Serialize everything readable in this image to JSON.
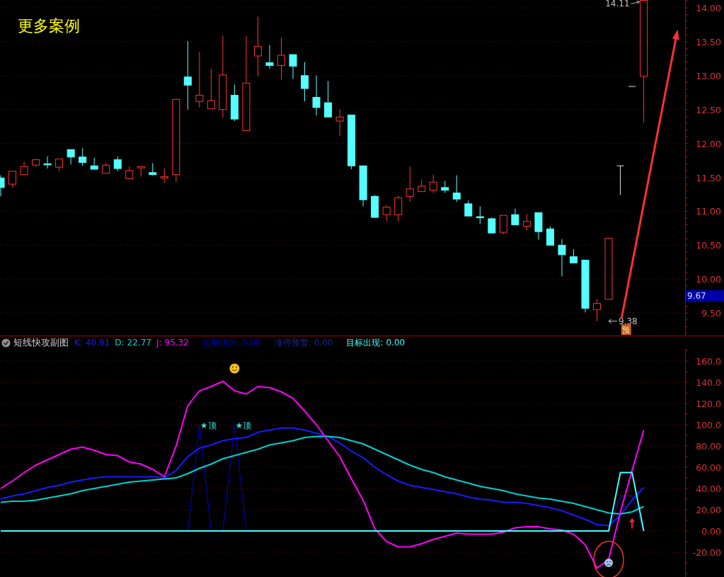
{
  "price_panel": {
    "overlay_label": "更多案例",
    "axis_labels": [
      "14.00",
      "13.50",
      "13.00",
      "12.50",
      "12.00",
      "11.50",
      "11.00",
      "10.50",
      "10.00",
      "9.50"
    ],
    "high_label": "14.11",
    "low_label": "9.38",
    "forecast_badge": "预",
    "price_tag": "9.67",
    "marks": [
      {
        "kind": "forecast_range"
      },
      {
        "kind": "forecast_level"
      },
      {
        "kind": "trend_arrow"
      }
    ]
  },
  "indicator_panel": {
    "title": "短线快攻副图",
    "legend_values": [
      "40.91",
      "22.77",
      "95.32",
      "0.00",
      "0.00",
      "0.00"
    ],
    "chart_data": {
      "type": "line",
      "ylim": [
        -43.3,
        171.3
      ],
      "grid": true,
      "yticks": [
        {
          "value": 160,
          "label": "160.0"
        },
        {
          "value": 140,
          "label": "140.0"
        },
        {
          "value": 120,
          "label": "120.0"
        },
        {
          "value": 100,
          "label": "100.0"
        },
        {
          "value": 80,
          "label": "80.00"
        },
        {
          "value": 60,
          "label": "60.00"
        },
        {
          "value": 40,
          "label": "40.00"
        },
        {
          "value": 20,
          "label": "20.00"
        },
        {
          "value": 0,
          "label": "0.00"
        },
        {
          "value": -20,
          "label": "-20.00"
        }
      ],
      "series": [
        {
          "name": "K:",
          "color": "#1a1aff",
          "values": [
            30,
            33,
            35,
            38,
            41,
            43,
            46,
            48,
            50,
            51,
            51,
            51,
            51,
            51,
            50,
            57,
            70,
            78,
            81,
            85,
            87,
            88,
            93,
            95,
            97,
            97,
            95,
            92,
            89,
            83,
            75,
            69,
            60,
            53,
            47,
            43,
            41,
            39,
            37,
            35,
            32,
            30,
            29,
            27,
            27,
            26,
            24,
            22,
            19,
            15,
            11,
            6,
            5,
            15,
            29,
            41
          ]
        },
        {
          "name": "D:",
          "color": "#00d0d0",
          "values": [
            27,
            28,
            28,
            29,
            31,
            33,
            35,
            38,
            40,
            42,
            44,
            46,
            47,
            48,
            49,
            50,
            54,
            59,
            63,
            68,
            71,
            74,
            77,
            81,
            83,
            85,
            88,
            89,
            89,
            88,
            85,
            82,
            77,
            72,
            67,
            62,
            58,
            55,
            51,
            48,
            45,
            42,
            40,
            38,
            35,
            33,
            31,
            30,
            28,
            26,
            23,
            20,
            17,
            16,
            18,
            23
          ]
        },
        {
          "name": "J:",
          "color": "#ff00ff",
          "values": [
            40,
            47,
            55,
            62,
            67,
            72,
            77,
            79,
            76,
            72,
            71,
            65,
            63,
            58,
            51,
            80,
            118,
            132,
            136,
            141,
            132,
            129,
            136,
            135,
            131,
            125,
            113,
            100,
            85,
            70,
            49,
            29,
            2,
            -10,
            -15,
            -15,
            -12,
            -8,
            -5,
            -2,
            -3,
            -3,
            -3,
            -1,
            3,
            4,
            4,
            2,
            1,
            -3,
            -13,
            -35,
            -27,
            18,
            57,
            95
          ]
        },
        {
          "name": "短期顶部:",
          "color": "#0000c8",
          "values": [
            null,
            null,
            null,
            null,
            null,
            null,
            null,
            null,
            null,
            null,
            null,
            null,
            null,
            null,
            null,
            null,
            0,
            100,
            0,
            0,
            100,
            0,
            null,
            null,
            null,
            null,
            null,
            null,
            null,
            null,
            null,
            null,
            null,
            null,
            null,
            null,
            null,
            null,
            null,
            null,
            null,
            null,
            null,
            null,
            null,
            null,
            null,
            null,
            null,
            null,
            null,
            null,
            null,
            null,
            null,
            null
          ]
        },
        {
          "name": "涨停预警:",
          "color": "#2020a0",
          "values": [
            null,
            null,
            null,
            null,
            null,
            null,
            null,
            null,
            null,
            null,
            null,
            null,
            null,
            null,
            null,
            null,
            null,
            null,
            null,
            null,
            null,
            null,
            null,
            null,
            null,
            null,
            null,
            null,
            null,
            null,
            null,
            null,
            null,
            null,
            null,
            null,
            null,
            null,
            null,
            null,
            null,
            null,
            null,
            null,
            null,
            null,
            null,
            null,
            null,
            null,
            null,
            null,
            0,
            33,
            33,
            0
          ]
        },
        {
          "name": "目标出现:",
          "color": "#40ffff",
          "values": [
            0,
            0,
            0,
            0,
            0,
            0,
            0,
            0,
            0,
            0,
            0,
            0,
            0,
            0,
            0,
            0,
            0,
            0,
            0,
            0,
            0,
            0,
            0,
            0,
            0,
            0,
            0,
            0,
            0,
            0,
            0,
            0,
            0,
            0,
            0,
            0,
            0,
            0,
            0,
            0,
            0,
            0,
            0,
            0,
            0,
            0,
            0,
            0,
            0,
            0,
            0,
            0,
            0,
            55,
            55,
            0
          ]
        }
      ],
      "annotations": [
        "★顶",
        "★顶"
      ]
    },
    "marks": [
      {
        "kind": "happy_face"
      },
      {
        "kind": "sad_face"
      },
      {
        "kind": "up_arrow"
      },
      {
        "kind": "circle"
      }
    ]
  }
}
